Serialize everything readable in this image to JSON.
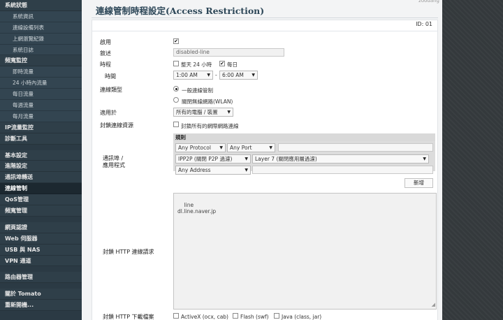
{
  "sidebar": {
    "items": [
      {
        "label": "系統狀態",
        "kind": "cat"
      },
      {
        "label": "系統資訊",
        "kind": "sub"
      },
      {
        "label": "連線設備列表",
        "kind": "sub"
      },
      {
        "label": "上網瀏覽紀錄",
        "kind": "sub"
      },
      {
        "label": "系統日誌",
        "kind": "sub"
      },
      {
        "label": "頻寬監控",
        "kind": "cat"
      },
      {
        "label": "即時流量",
        "kind": "sub"
      },
      {
        "label": "24 小時內流量",
        "kind": "sub"
      },
      {
        "label": "每日流量",
        "kind": "sub"
      },
      {
        "label": "每週流量",
        "kind": "sub"
      },
      {
        "label": "每月流量",
        "kind": "sub"
      },
      {
        "label": "IP流量監控",
        "kind": "cat"
      },
      {
        "label": "診斷工具",
        "kind": "cat"
      },
      {
        "label": "",
        "kind": "gap"
      },
      {
        "label": "基本設定",
        "kind": "cat"
      },
      {
        "label": "進階設定",
        "kind": "cat"
      },
      {
        "label": "通訊埠轉送",
        "kind": "cat"
      },
      {
        "label": "連線管制",
        "kind": "cat",
        "active": true
      },
      {
        "label": "QoS管理",
        "kind": "cat"
      },
      {
        "label": "頻寬管理",
        "kind": "cat"
      },
      {
        "label": "",
        "kind": "gap"
      },
      {
        "label": "網頁認證",
        "kind": "cat"
      },
      {
        "label": "Web 伺服器",
        "kind": "cat"
      },
      {
        "label": "USB 與 NAS",
        "kind": "cat"
      },
      {
        "label": "VPN 通道",
        "kind": "cat"
      },
      {
        "label": "",
        "kind": "gap"
      },
      {
        "label": "路由器管理",
        "kind": "cat"
      },
      {
        "label": "",
        "kind": "gap"
      },
      {
        "label": "關於 Tomato",
        "kind": "cat"
      },
      {
        "label": "重新開機...",
        "kind": "cat"
      }
    ]
  },
  "header": {
    "user": "zoodang",
    "title": "連線管制時程設定(Access Restriction)",
    "id_label": "ID: 01"
  },
  "form": {
    "enable": {
      "label": "啟用",
      "checked": true
    },
    "description": {
      "label": "敘述",
      "value": "disabled-line"
    },
    "time": {
      "label": "時程",
      "all_day_label": "整天 24 小時",
      "all_day_checked": false,
      "every_day_label": "每日",
      "every_day_checked": true
    },
    "hours": {
      "label": "時間",
      "start": "1:00 AM",
      "sep": "-",
      "end": "6:00 AM"
    },
    "type": {
      "label": "連線類型",
      "option1": "一般連線管制",
      "option2": "關閉無線網路(WLAN)",
      "selected": "option1"
    },
    "applies": {
      "label": "適用於",
      "value": "所有的電腦 / 裝置"
    },
    "block_all": {
      "label": "封鎖連線資源",
      "check_label": "封鎖所有的網際網路連線",
      "checked": false
    },
    "rules": {
      "header": "規則",
      "protocol": "Any Protocol",
      "port": "Any Port",
      "ipp2p": "IPP2P (關閉 P2P 過濾)",
      "layer7": "Layer 7 (關閉應用層過濾)",
      "address": "Any Address",
      "add_button": "新增"
    },
    "port_app_label_1": "通訊埠 /",
    "port_app_label_2": "應用程式",
    "http_block": {
      "label": "封鎖 HTTP 連線請求",
      "lines": "line\ndl.line.naver.jp"
    },
    "http_download": {
      "label": "封鎖 HTTP 下載檔案",
      "activex": "ActiveX (ocx, cab)",
      "flash": "Flash (swf)",
      "java": "Java (class, jar)"
    }
  },
  "colors": {
    "accent": "#2d4758",
    "sidebar": "#2b3a44"
  }
}
